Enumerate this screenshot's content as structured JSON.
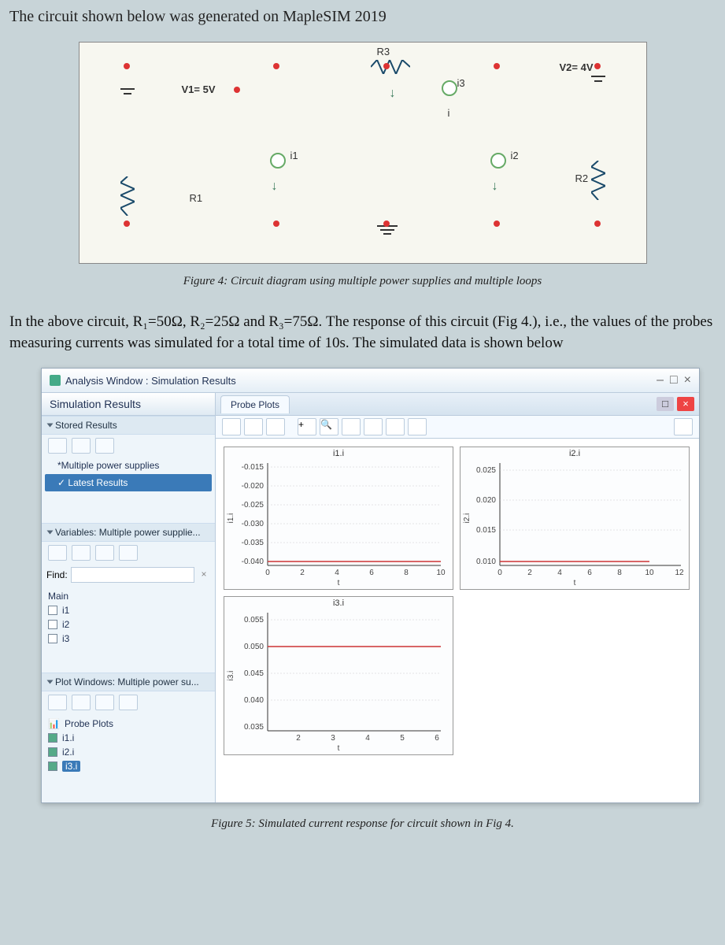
{
  "heading": "The circuit shown below was generated on MapleSIM 2019",
  "circuit": {
    "V1": "V1= 5V",
    "V2": "V2= 4V",
    "R1": "R1",
    "R2": "R2",
    "R3": "R3",
    "i1": "i1",
    "i2": "i2",
    "i3": "i3",
    "i": "i"
  },
  "figure4_caption": "Figure 4: Circuit diagram using multiple power supplies and multiple loops",
  "paragraph": "In the above circuit, R₁=50Ω, R₂=25Ω and R₃=75Ω.  The response of this circuit (Fig 4.), i.e., the values of the probes measuring currents was simulated for a total time of 10s.  The simulated data is shown below",
  "window": {
    "title": "Analysis Window : Simulation Results",
    "sidebar_title": "Simulation Results",
    "stored_hdr": "Stored Results",
    "tree_parent": "*Multiple power supplies",
    "tree_child": "Latest Results",
    "variables_hdr": "Variables: Multiple power supplie...",
    "find_label": "Find:",
    "main_label": "Main",
    "probe_i1": "i1",
    "probe_i2": "i2",
    "probe_i3": "i3",
    "plotwin_hdr": "Plot Windows: Multiple power su...",
    "probe_plots_item": "Probe Plots",
    "pi1": "i1.i",
    "pi2": "i2.i",
    "pi3": "i3.i",
    "tab": "Probe Plots"
  },
  "chart_data": [
    {
      "type": "line",
      "title": "i1.i",
      "ylabel": "i1.i",
      "xlabel": "t",
      "x": [
        0,
        2,
        4,
        6,
        8,
        10
      ],
      "y_ticks": [
        -0.015,
        -0.02,
        -0.025,
        -0.03,
        -0.035,
        -0.04
      ],
      "constant_value": -0.04
    },
    {
      "type": "line",
      "title": "i2.i",
      "ylabel": "i2.i",
      "xlabel": "t",
      "x": [
        0,
        2,
        4,
        6,
        8,
        10,
        12
      ],
      "y_ticks": [
        0.025,
        0.02,
        0.015,
        0.01
      ],
      "constant_value": 0.01
    },
    {
      "type": "line",
      "title": "i3.i",
      "ylabel": "i3.i",
      "xlabel": "t",
      "x": [
        2,
        3,
        4,
        5,
        6
      ],
      "y_ticks": [
        0.055,
        0.05,
        0.045,
        0.04,
        0.035
      ],
      "constant_value": 0.05
    }
  ],
  "figure5_caption": "Figure 5: Simulated current response for circuit shown in Fig 4."
}
